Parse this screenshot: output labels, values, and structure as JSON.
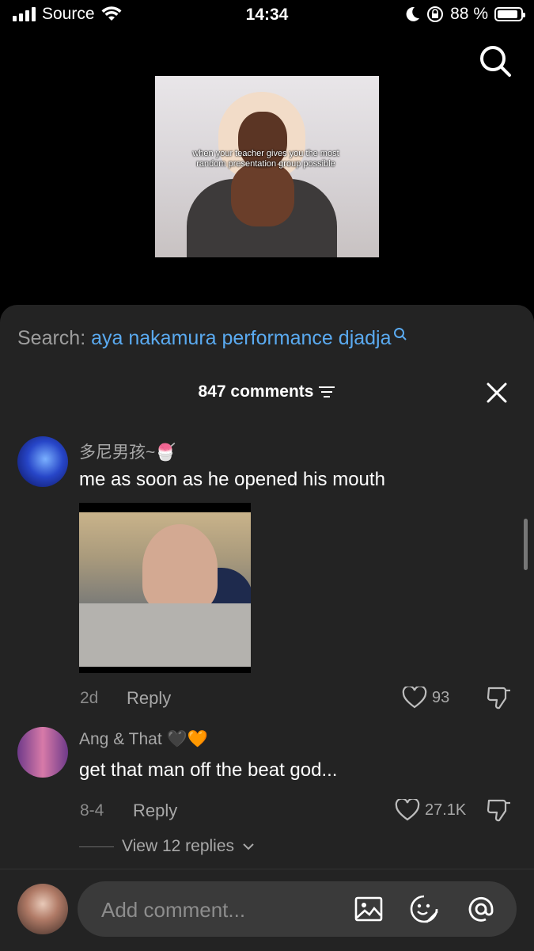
{
  "status_bar": {
    "carrier": "Source",
    "time": "14:34",
    "battery": "88 %",
    "battery_level": 0.88
  },
  "video": {
    "caption": "when your teacher gives you the most random presentation group possible"
  },
  "sheet": {
    "search_prefix": "Search:",
    "search_query": "aya nakamura performance djadja",
    "comment_count": "847 comments"
  },
  "comments": [
    {
      "username": "多尼男孩~🍧",
      "text": "me as soon as he opened his mouth",
      "age": "2d",
      "reply_label": "Reply",
      "likes": "93",
      "has_gif": true
    },
    {
      "username": "Ang & That 🖤🧡",
      "text": "get that man off the beat god...",
      "age": "8-4",
      "reply_label": "Reply",
      "likes": "27.1K",
      "view_replies": "View 12 replies"
    }
  ],
  "composer": {
    "placeholder": "Add comment..."
  },
  "icons": [
    "search-icon",
    "filter-icon",
    "close-icon",
    "heart-icon",
    "dislike-icon",
    "image-icon",
    "emoji-icon",
    "mention-icon",
    "chevron-down-icon",
    "wifi-icon",
    "moon-icon",
    "lock-rotation-icon",
    "battery-icon",
    "signal-icon"
  ]
}
